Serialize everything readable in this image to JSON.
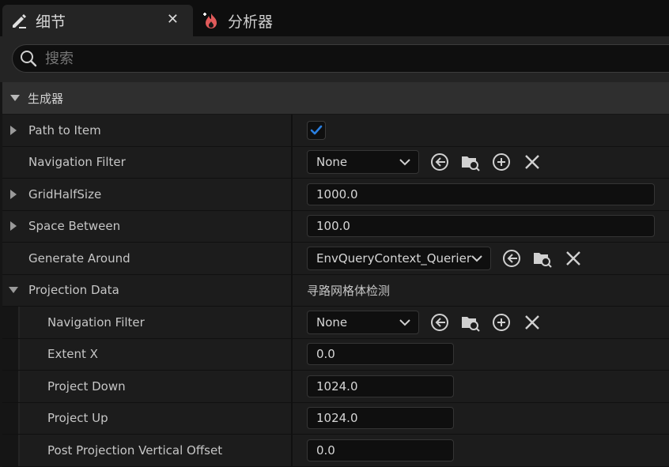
{
  "tabs": [
    {
      "label": "细节",
      "icon": "pencil-icon",
      "active": true
    },
    {
      "label": "分析器",
      "icon": "profiler-flame-icon",
      "active": false
    }
  ],
  "search": {
    "placeholder": "搜索"
  },
  "category": {
    "label": "生成器"
  },
  "rows": {
    "path_to_item": {
      "label": "Path to Item",
      "checked": true
    },
    "nav_filter": {
      "label": "Navigation Filter",
      "value": "None"
    },
    "grid_half_size": {
      "label": "GridHalfSize",
      "value": "1000.0"
    },
    "space_between": {
      "label": "Space Between",
      "value": "100.0"
    },
    "generate_around": {
      "label": "Generate Around",
      "value": "EnvQueryContext_Querier"
    },
    "projection_data": {
      "label": "Projection Data",
      "value": "寻路网格体检测"
    },
    "proj_nav_filter": {
      "label": "Navigation Filter",
      "value": "None"
    },
    "extent_x": {
      "label": "Extent X",
      "value": "0.0"
    },
    "project_down": {
      "label": "Project Down",
      "value": "1024.0"
    },
    "project_up": {
      "label": "Project Up",
      "value": "1024.0"
    },
    "post_offset": {
      "label": "Post Projection Vertical Offset",
      "value": "0.0"
    }
  },
  "colors": {
    "accent": "#2a7fe0",
    "panel": "#1c1c1c",
    "background": "#151515"
  }
}
